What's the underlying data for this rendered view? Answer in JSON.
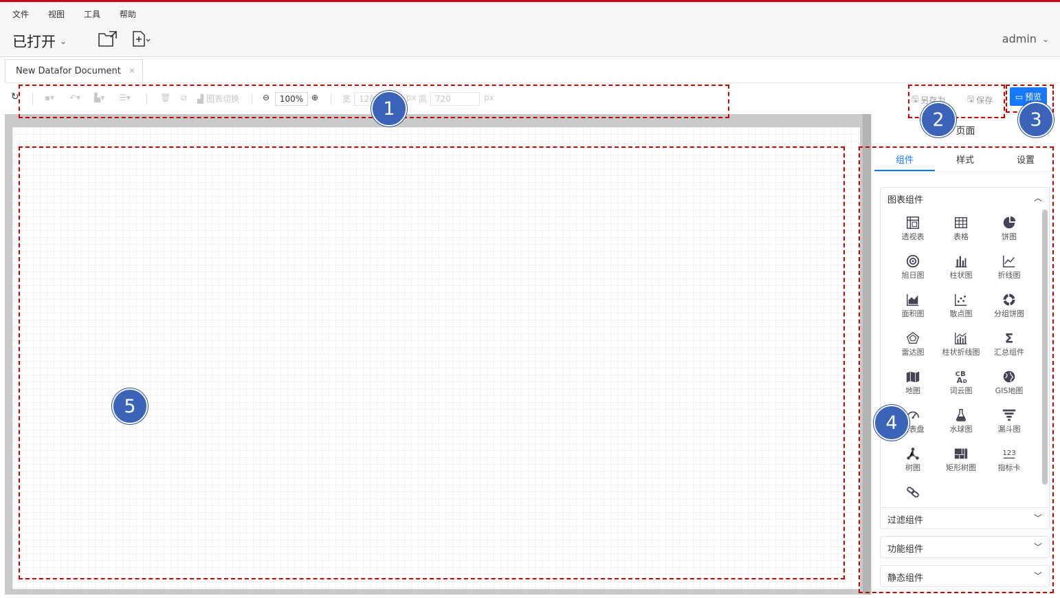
{
  "menu": [
    "文件",
    "视图",
    "工具",
    "帮助"
  ],
  "app": {
    "opened_label": "已打开",
    "user": "admin"
  },
  "doc_tab": {
    "title": "New Datafor Document"
  },
  "toolbar": {
    "chart_switch": "图表切换",
    "zoom": "100%",
    "width_label": "宽",
    "width_value": "1280",
    "px1": "px",
    "height_label": "高",
    "height_value": "720",
    "px2": "px",
    "save_as": "另存为",
    "save": "保存",
    "preview": "预览"
  },
  "panel": {
    "title": "页面",
    "tabs": [
      "组件",
      "样式",
      "设置"
    ],
    "sections": [
      "图表组件",
      "过滤组件",
      "功能组件",
      "静态组件"
    ],
    "components": [
      {
        "label": "透视表",
        "icon": "pivot-table-icon"
      },
      {
        "label": "表格",
        "icon": "table-icon"
      },
      {
        "label": "饼图",
        "icon": "pie-chart-icon"
      },
      {
        "label": "旭日图",
        "icon": "sunburst-icon"
      },
      {
        "label": "柱状图",
        "icon": "bar-chart-icon"
      },
      {
        "label": "折线图",
        "icon": "line-chart-icon"
      },
      {
        "label": "面积图",
        "icon": "area-chart-icon"
      },
      {
        "label": "散点图",
        "icon": "scatter-icon"
      },
      {
        "label": "分组饼图",
        "icon": "donut-icon"
      },
      {
        "label": "雷达图",
        "icon": "radar-icon"
      },
      {
        "label": "柱状折线图",
        "icon": "bar-line-icon"
      },
      {
        "label": "汇总组件",
        "icon": "sigma-icon"
      },
      {
        "label": "地图",
        "icon": "map-icon"
      },
      {
        "label": "词云图",
        "icon": "word-cloud-icon"
      },
      {
        "label": "GIS地图",
        "icon": "globe-icon"
      },
      {
        "label": "仪表盘",
        "icon": "gauge-icon"
      },
      {
        "label": "水球图",
        "icon": "flask-icon"
      },
      {
        "label": "漏斗图",
        "icon": "funnel-icon"
      },
      {
        "label": "树图",
        "icon": "tree-icon"
      },
      {
        "label": "矩形树图",
        "icon": "treemap-icon"
      },
      {
        "label": "指标卡",
        "icon": "kpi-icon"
      },
      {
        "label": "",
        "icon": "link-icon"
      }
    ]
  },
  "annotations": [
    "1",
    "2",
    "3",
    "4",
    "5"
  ]
}
